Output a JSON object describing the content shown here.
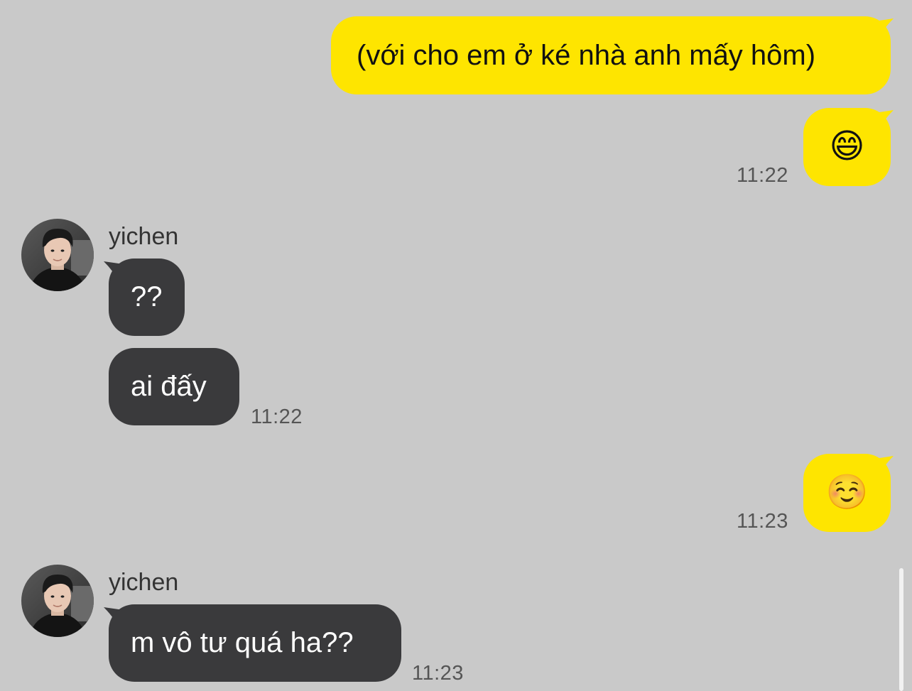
{
  "colors": {
    "background": "#c9c9c9",
    "my_bubble": "#fee500",
    "their_bubble": "#3a3a3c",
    "timestamp": "#555555"
  },
  "messages": [
    {
      "from": "me",
      "text": "(với cho em ở ké nhà anh mấy hôm)"
    },
    {
      "from": "me",
      "text": "😄",
      "time": "11:22"
    },
    {
      "from": "yichen",
      "sender": "yichen",
      "text": "??"
    },
    {
      "from": "yichen",
      "text": "ai đấy",
      "time": "11:22"
    },
    {
      "from": "me",
      "text": "☺️",
      "time": "11:23"
    },
    {
      "from": "yichen",
      "sender": "yichen",
      "text": "m vô tư quá ha??",
      "time": "11:23"
    }
  ]
}
